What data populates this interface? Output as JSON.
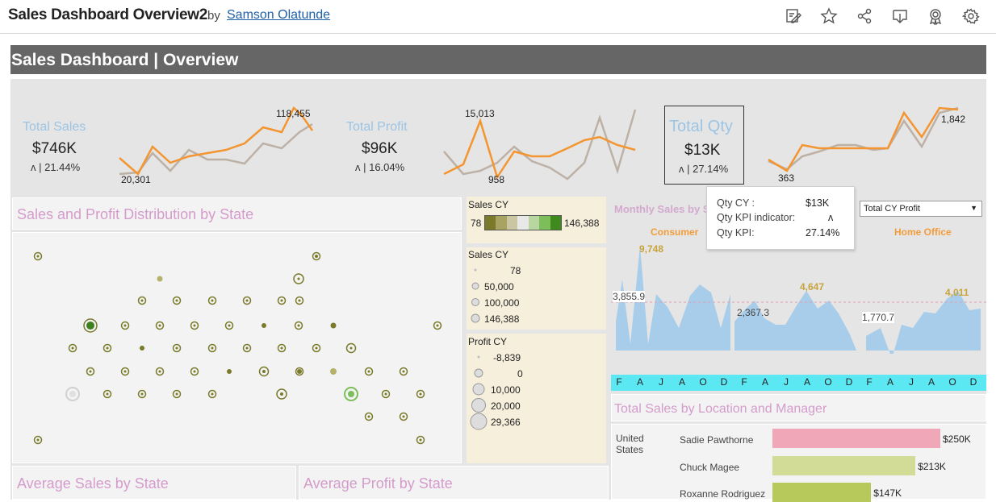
{
  "header": {
    "title": "Sales Dashboard Overview2",
    "by": "by",
    "author": "Samson Olatunde",
    "icons": [
      "edit-icon",
      "star-icon",
      "share-icon",
      "download-icon",
      "badge-icon",
      "settings-icon"
    ]
  },
  "dashboard": {
    "title": "Sales Dashboard | Overview"
  },
  "kpis": {
    "sales": {
      "title": "Total Sales",
      "value": "$746K",
      "change": "ʌ | 21.44%",
      "min_label": "20,301",
      "max_label": "118,455"
    },
    "profit": {
      "title": "Total Profit",
      "value": "$96K",
      "change": "ʌ | 16.04%",
      "min_label": "958",
      "max_label": "15,013"
    },
    "qty": {
      "title": "Total Qty",
      "value": "$13K",
      "change": "ʌ | 27.14%",
      "min_label": "363",
      "max_label": "1,842"
    }
  },
  "tooltip": {
    "rows": [
      {
        "label": "Qty CY :",
        "value": "$13K"
      },
      {
        "label": "Qty KPI indicator:",
        "value": "ʌ"
      },
      {
        "label": "Qty KPI:",
        "value": "27.14%"
      }
    ]
  },
  "sections": {
    "distribution": "Sales and Profit Distribution by State",
    "avg_sales": "Average Sales by State",
    "avg_profit": "Average Profit by State",
    "location": "Total Sales by Location and Manager",
    "monthly": "Monthly  Sales by S"
  },
  "legends": {
    "sales_color": {
      "title": "Sales CY",
      "min": "78",
      "max": "146,388"
    },
    "sales_size": {
      "title": "Sales CY",
      "items": [
        "78",
        "50,000",
        "100,000",
        "146,388"
      ]
    },
    "profit_size": {
      "title": "Profit CY",
      "items": [
        "-8,839",
        "0",
        "10,000",
        "20,000",
        "29,366"
      ]
    }
  },
  "monthly": {
    "dropdown": "Total CY Profit",
    "segments": [
      "Consumer",
      "Home Office"
    ],
    "averages": [
      "3,855.9",
      "2,367.3",
      "1,770.7"
    ],
    "peaks": [
      "9,748",
      "4,647",
      "4,011"
    ],
    "months": [
      "F",
      "A",
      "J",
      "A",
      "O",
      "D",
      "F",
      "A",
      "J",
      "A",
      "O",
      "D",
      "F",
      "A",
      "J",
      "A",
      "O",
      "D"
    ]
  },
  "location": {
    "country": "United States",
    "managers": [
      {
        "name": "Sadie Pawthorne",
        "value": "$250K",
        "amount": 250,
        "color": "#f0a8b8"
      },
      {
        "name": "Chuck Magee",
        "value": "$213K",
        "amount": 213,
        "color": "#d3dc96"
      },
      {
        "name": "Roxanne Rodriguez",
        "value": "$147K",
        "amount": 147,
        "color": "#b7c95a"
      }
    ]
  },
  "colors": {
    "header_bg": "#666666",
    "sales_line": "#f39530",
    "prior_line": "#bdb1a6",
    "kpi_title": "#9cc4e4",
    "section_title": "#d49ccb",
    "month_bar": "#5ce8f2",
    "area": "#a8cdea",
    "map_dot": "#7a7a2a"
  }
}
